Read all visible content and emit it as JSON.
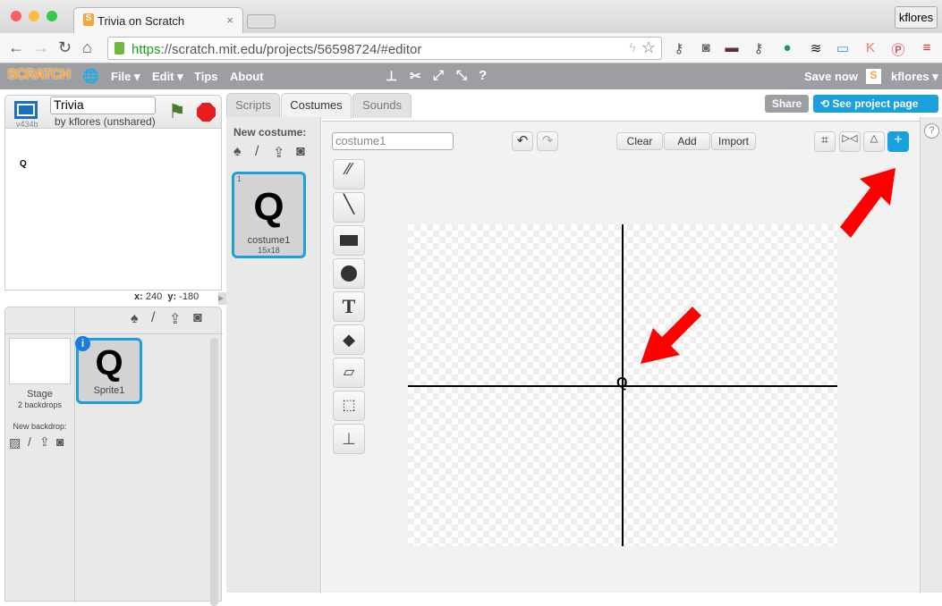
{
  "browser": {
    "tab_title": "Trivia on Scratch",
    "tab_close": "×",
    "user": "kflores",
    "url_scheme": "https",
    "url_rest": "://scratch.mit.edu/projects/56598724/#editor",
    "traffic_colors": [
      "#fc605c",
      "#fdbc40",
      "#34c84a"
    ]
  },
  "menubar": {
    "logo": "SCRATCH",
    "items": [
      "File ▾",
      "Edit ▾",
      "Tips",
      "About"
    ],
    "save": "Save now",
    "user": "kflores ▾"
  },
  "project": {
    "title": "Trivia",
    "version": "v434b",
    "byline": "by kflores (unshared)",
    "share": "Share",
    "see_page": "See project page"
  },
  "stage": {
    "x_label": "x:",
    "x": "240",
    "y_label": "y:",
    "y": "-180",
    "sprite_glyph": "Q"
  },
  "sprites": {
    "stage_label": "Stage",
    "backdrops": "2 backdrops",
    "new_backdrop": "New backdrop:",
    "items": [
      {
        "name": "Sprite1",
        "glyph": "Q"
      }
    ]
  },
  "tabs": [
    "Scripts",
    "Costumes",
    "Sounds"
  ],
  "costumes": {
    "new_label": "New costume:",
    "items": [
      {
        "index": "1",
        "glyph": "Q",
        "name": "costume1",
        "size": "15x18"
      }
    ]
  },
  "editor": {
    "name_value": "costume1",
    "clear": "Clear",
    "add": "Add",
    "import": "Import",
    "tools": [
      "brush",
      "line",
      "rectangle",
      "ellipse",
      "text",
      "fill",
      "eraser",
      "select",
      "stamp"
    ],
    "accent": "#1aa0dc",
    "arrow_color": "#ff0000"
  },
  "help": "?"
}
